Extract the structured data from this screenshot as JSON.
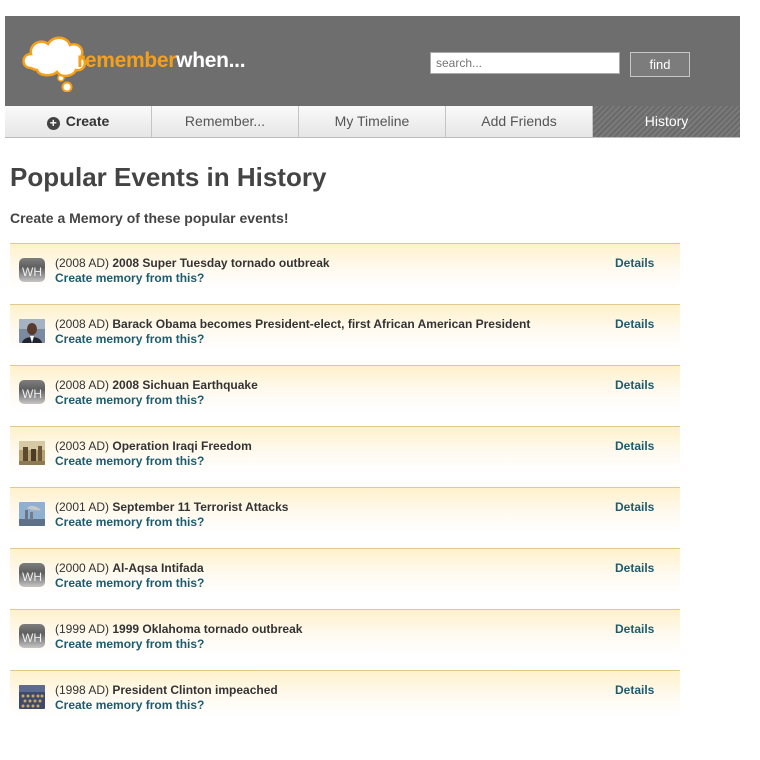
{
  "logo": {
    "part1": "remember",
    "part2": "when..."
  },
  "search": {
    "placeholder": "search...",
    "find_label": "find"
  },
  "nav": [
    {
      "label": "Create",
      "icon": "plus-circle-icon"
    },
    {
      "label": "Remember..."
    },
    {
      "label": "My Timeline"
    },
    {
      "label": "Add Friends"
    },
    {
      "label": "History",
      "active": true
    }
  ],
  "page": {
    "title": "Popular Events in History",
    "subtitle": "Create a Memory of these popular events!"
  },
  "events": [
    {
      "year": "(2008 AD)",
      "title": "2008 Super Tuesday tornado outbreak",
      "create": "Create memory from this?",
      "details": "Details",
      "thumb": "wh-placeholder-icon"
    },
    {
      "year": "(2008 AD)",
      "title": "Barack Obama becomes President-elect, first African American President",
      "create": "Create memory from this?",
      "details": "Details",
      "thumb": "portrait-photo"
    },
    {
      "year": "(2008 AD)",
      "title": "2008 Sichuan Earthquake",
      "create": "Create memory from this?",
      "details": "Details",
      "thumb": "wh-placeholder-icon"
    },
    {
      "year": "(2003 AD)",
      "title": "Operation Iraqi Freedom",
      "create": "Create memory from this?",
      "details": "Details",
      "thumb": "soldiers-photo"
    },
    {
      "year": "(2001 AD)",
      "title": "September 11 Terrorist Attacks",
      "create": "Create memory from this?",
      "details": "Details",
      "thumb": "skyline-photo"
    },
    {
      "year": "(2000 AD)",
      "title": "Al-Aqsa Intifada",
      "create": "Create memory from this?",
      "details": "Details",
      "thumb": "wh-placeholder-icon"
    },
    {
      "year": "(1999 AD)",
      "title": "1999 Oklahoma tornado outbreak",
      "create": "Create memory from this?",
      "details": "Details",
      "thumb": "wh-placeholder-icon"
    },
    {
      "year": "(1998 AD)",
      "title": "President Clinton impeached",
      "create": "Create memory from this?",
      "details": "Details",
      "thumb": "chamber-photo"
    }
  ],
  "colors": {
    "accent": "#f6a01a",
    "header": "#6e6e6e",
    "link": "#1d5c6e",
    "row_border": "#e3c98a"
  }
}
